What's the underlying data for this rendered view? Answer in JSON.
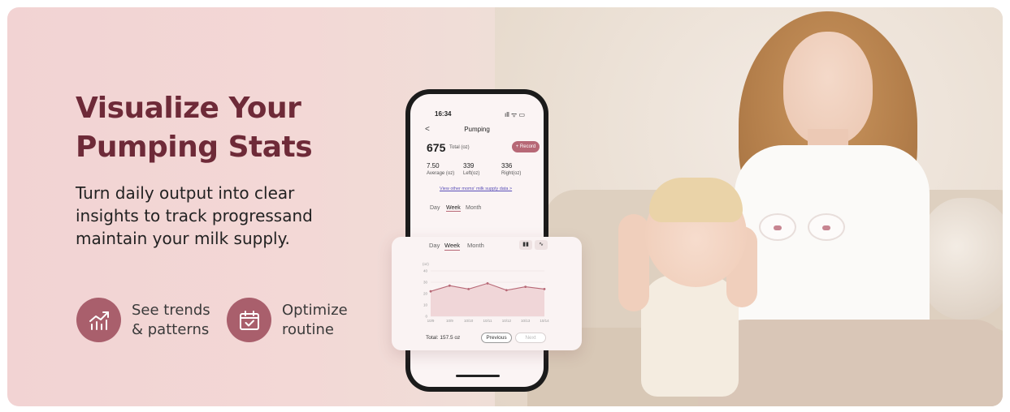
{
  "banner": {
    "headline": [
      "Visualize Your",
      "Pumping Stats"
    ],
    "subtext": [
      "Turn daily output into clear",
      "insights to track progressand",
      "maintain your milk supply."
    ],
    "features": [
      {
        "icon": "trend-chart-icon",
        "lines": [
          "See trends",
          "& patterns"
        ]
      },
      {
        "icon": "calendar-check-icon",
        "lines": [
          "Optimize",
          "routine"
        ]
      }
    ],
    "colors": {
      "headline": "#6e2a38",
      "accent": "#a95f6c",
      "background": "#f2d3d3"
    }
  },
  "phone": {
    "time": "16:34",
    "status": "ıll ᯤ ▭",
    "back": "<",
    "title": "Pumping",
    "total_value": "675",
    "total_label": "Total (oz)",
    "record_button": "+ Record",
    "stats": [
      {
        "value": "7.50",
        "label": "Average (oz)"
      },
      {
        "value": "339",
        "label": "Left(oz)"
      },
      {
        "value": "336",
        "label": "Right(oz)"
      }
    ],
    "link": "View other moms' milk supply data  >",
    "tabs": [
      "Day",
      "Week",
      "Month"
    ],
    "active_tab": "Week"
  },
  "card": {
    "tabs": [
      "Day",
      "Week",
      "Month"
    ],
    "active_tab": "Week",
    "bar_icon": "bar-chart-icon",
    "line_icon": "line-chart-icon",
    "total": "Total: 157.5 oz",
    "previous": "Previous",
    "next": "Next"
  },
  "chart_data": {
    "type": "area",
    "title": "",
    "xlabel": "",
    "ylabel": "",
    "y_unit": "(oz)",
    "ylim": [
      0,
      40
    ],
    "yticks": [
      0,
      10,
      20,
      30,
      40
    ],
    "categories": [
      "10/9",
      "10/9",
      "10/10",
      "10/11",
      "10/12",
      "10/13",
      "10/14"
    ],
    "series": [
      {
        "values": [
          22,
          27,
          24,
          29,
          23,
          26,
          24
        ]
      }
    ],
    "grid": true,
    "fill_color": "#f0d6d8",
    "line_color": "#b76876"
  }
}
